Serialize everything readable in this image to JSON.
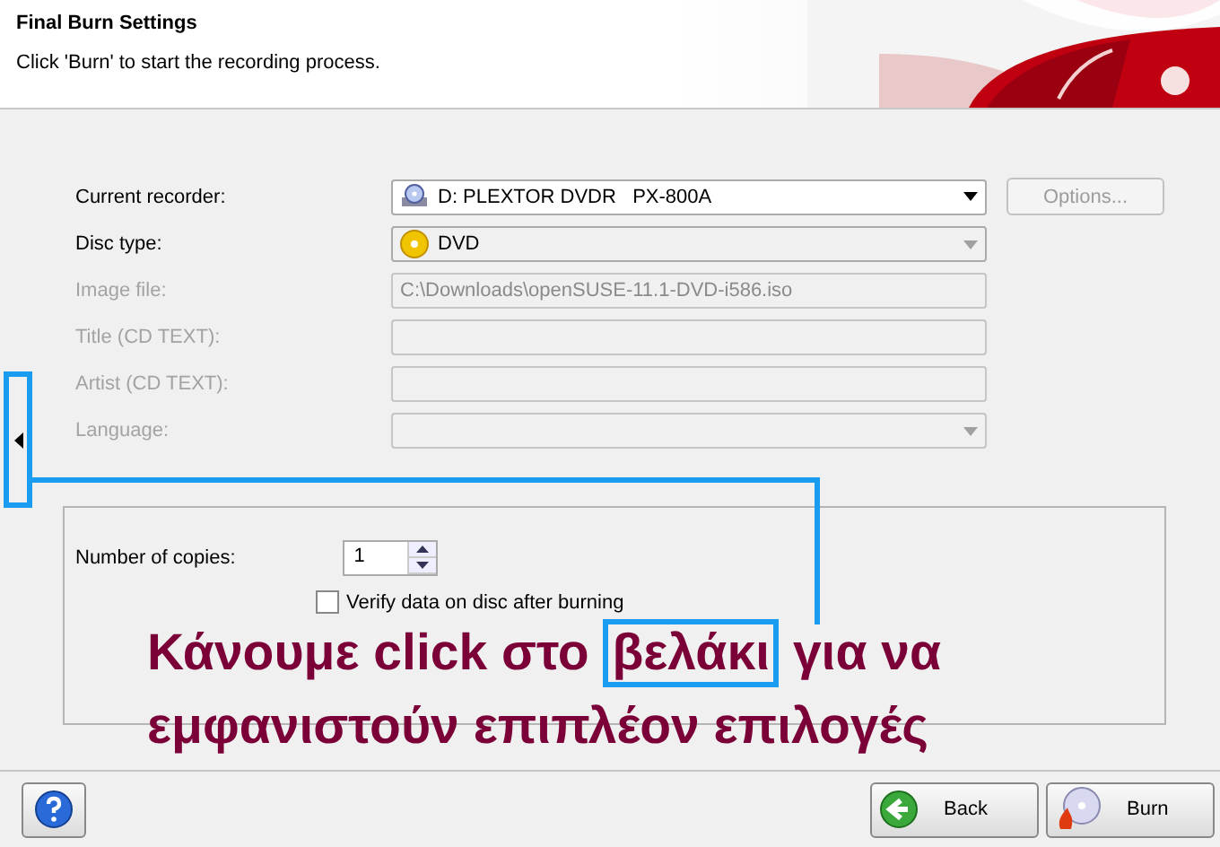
{
  "header": {
    "title": "Final Burn Settings",
    "subtitle": "Click 'Burn' to start the recording process."
  },
  "fields": [
    {
      "label": "Current recorder:",
      "kind": "dropdown",
      "value": "D: PLEXTOR DVDR   PX-800A",
      "disabled": false
    },
    {
      "label": "Disc type:",
      "kind": "list",
      "value": "DVD",
      "disabled": false
    },
    {
      "label": "Image file:",
      "kind": "text",
      "value": "C:\\Downloads\\openSUSE-11.1-DVD-i586.iso",
      "disabled": true
    },
    {
      "label": "Title (CD TEXT):",
      "kind": "text",
      "disabled": true
    },
    {
      "label": "Artist (CD TEXT):",
      "kind": "text",
      "disabled": true
    },
    {
      "label": "Language:",
      "kind": "dropdown",
      "disabled": true
    }
  ],
  "options_button": {
    "label": "Options...",
    "disabled": true
  },
  "copies": {
    "label": "Number of copies:",
    "value": "1"
  },
  "verify": {
    "label": "Verify data on disc after burning",
    "checked": false
  },
  "annotation": {
    "before": "Κάνουμε click στο",
    "highlighted": "βελάκι",
    "after": "για να εμφανιστούν επιπλέον επιλογές"
  },
  "buttons": [
    {
      "label": "Back"
    },
    {
      "label": "Burn"
    }
  ]
}
